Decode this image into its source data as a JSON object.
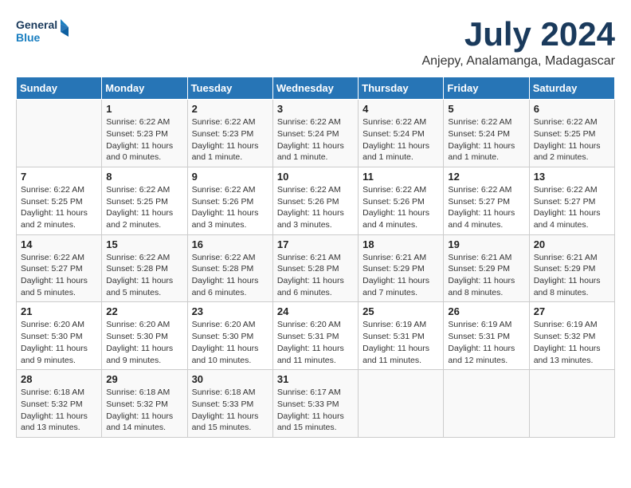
{
  "header": {
    "logo_line1": "General",
    "logo_line2": "Blue",
    "month": "July 2024",
    "location": "Anjepy, Analamanga, Madagascar"
  },
  "weekdays": [
    "Sunday",
    "Monday",
    "Tuesday",
    "Wednesday",
    "Thursday",
    "Friday",
    "Saturday"
  ],
  "weeks": [
    [
      {
        "day": "",
        "text": ""
      },
      {
        "day": "1",
        "text": "Sunrise: 6:22 AM\nSunset: 5:23 PM\nDaylight: 11 hours\nand 0 minutes."
      },
      {
        "day": "2",
        "text": "Sunrise: 6:22 AM\nSunset: 5:23 PM\nDaylight: 11 hours\nand 1 minute."
      },
      {
        "day": "3",
        "text": "Sunrise: 6:22 AM\nSunset: 5:24 PM\nDaylight: 11 hours\nand 1 minute."
      },
      {
        "day": "4",
        "text": "Sunrise: 6:22 AM\nSunset: 5:24 PM\nDaylight: 11 hours\nand 1 minute."
      },
      {
        "day": "5",
        "text": "Sunrise: 6:22 AM\nSunset: 5:24 PM\nDaylight: 11 hours\nand 1 minute."
      },
      {
        "day": "6",
        "text": "Sunrise: 6:22 AM\nSunset: 5:25 PM\nDaylight: 11 hours\nand 2 minutes."
      }
    ],
    [
      {
        "day": "7",
        "text": "Sunrise: 6:22 AM\nSunset: 5:25 PM\nDaylight: 11 hours\nand 2 minutes."
      },
      {
        "day": "8",
        "text": "Sunrise: 6:22 AM\nSunset: 5:25 PM\nDaylight: 11 hours\nand 2 minutes."
      },
      {
        "day": "9",
        "text": "Sunrise: 6:22 AM\nSunset: 5:26 PM\nDaylight: 11 hours\nand 3 minutes."
      },
      {
        "day": "10",
        "text": "Sunrise: 6:22 AM\nSunset: 5:26 PM\nDaylight: 11 hours\nand 3 minutes."
      },
      {
        "day": "11",
        "text": "Sunrise: 6:22 AM\nSunset: 5:26 PM\nDaylight: 11 hours\nand 4 minutes."
      },
      {
        "day": "12",
        "text": "Sunrise: 6:22 AM\nSunset: 5:27 PM\nDaylight: 11 hours\nand 4 minutes."
      },
      {
        "day": "13",
        "text": "Sunrise: 6:22 AM\nSunset: 5:27 PM\nDaylight: 11 hours\nand 4 minutes."
      }
    ],
    [
      {
        "day": "14",
        "text": "Sunrise: 6:22 AM\nSunset: 5:27 PM\nDaylight: 11 hours\nand 5 minutes."
      },
      {
        "day": "15",
        "text": "Sunrise: 6:22 AM\nSunset: 5:28 PM\nDaylight: 11 hours\nand 5 minutes."
      },
      {
        "day": "16",
        "text": "Sunrise: 6:22 AM\nSunset: 5:28 PM\nDaylight: 11 hours\nand 6 minutes."
      },
      {
        "day": "17",
        "text": "Sunrise: 6:21 AM\nSunset: 5:28 PM\nDaylight: 11 hours\nand 6 minutes."
      },
      {
        "day": "18",
        "text": "Sunrise: 6:21 AM\nSunset: 5:29 PM\nDaylight: 11 hours\nand 7 minutes."
      },
      {
        "day": "19",
        "text": "Sunrise: 6:21 AM\nSunset: 5:29 PM\nDaylight: 11 hours\nand 8 minutes."
      },
      {
        "day": "20",
        "text": "Sunrise: 6:21 AM\nSunset: 5:29 PM\nDaylight: 11 hours\nand 8 minutes."
      }
    ],
    [
      {
        "day": "21",
        "text": "Sunrise: 6:20 AM\nSunset: 5:30 PM\nDaylight: 11 hours\nand 9 minutes."
      },
      {
        "day": "22",
        "text": "Sunrise: 6:20 AM\nSunset: 5:30 PM\nDaylight: 11 hours\nand 9 minutes."
      },
      {
        "day": "23",
        "text": "Sunrise: 6:20 AM\nSunset: 5:30 PM\nDaylight: 11 hours\nand 10 minutes."
      },
      {
        "day": "24",
        "text": "Sunrise: 6:20 AM\nSunset: 5:31 PM\nDaylight: 11 hours\nand 11 minutes."
      },
      {
        "day": "25",
        "text": "Sunrise: 6:19 AM\nSunset: 5:31 PM\nDaylight: 11 hours\nand 11 minutes."
      },
      {
        "day": "26",
        "text": "Sunrise: 6:19 AM\nSunset: 5:31 PM\nDaylight: 11 hours\nand 12 minutes."
      },
      {
        "day": "27",
        "text": "Sunrise: 6:19 AM\nSunset: 5:32 PM\nDaylight: 11 hours\nand 13 minutes."
      }
    ],
    [
      {
        "day": "28",
        "text": "Sunrise: 6:18 AM\nSunset: 5:32 PM\nDaylight: 11 hours\nand 13 minutes."
      },
      {
        "day": "29",
        "text": "Sunrise: 6:18 AM\nSunset: 5:32 PM\nDaylight: 11 hours\nand 14 minutes."
      },
      {
        "day": "30",
        "text": "Sunrise: 6:18 AM\nSunset: 5:33 PM\nDaylight: 11 hours\nand 15 minutes."
      },
      {
        "day": "31",
        "text": "Sunrise: 6:17 AM\nSunset: 5:33 PM\nDaylight: 11 hours\nand 15 minutes."
      },
      {
        "day": "",
        "text": ""
      },
      {
        "day": "",
        "text": ""
      },
      {
        "day": "",
        "text": ""
      }
    ]
  ]
}
